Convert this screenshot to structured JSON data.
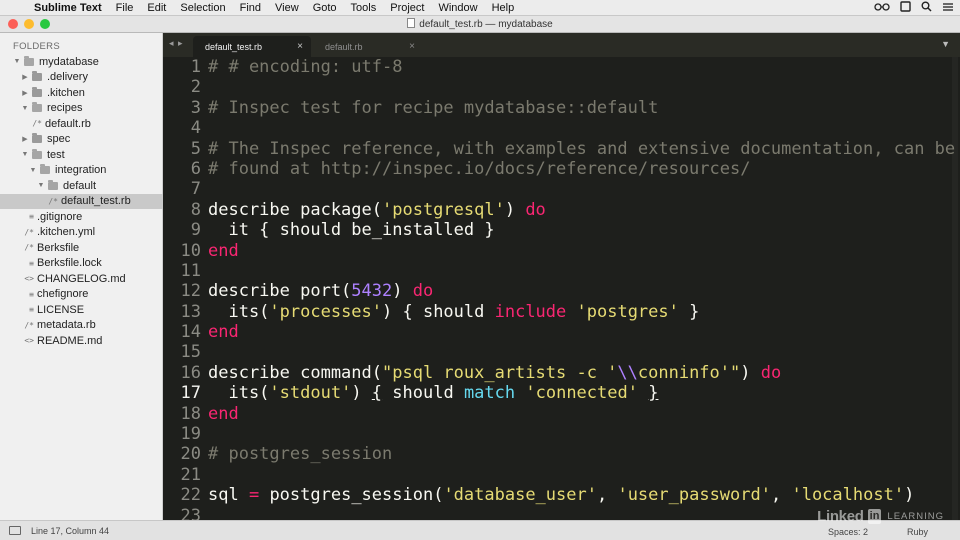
{
  "menubar": {
    "apple_icon": "",
    "app_name": "Sublime Text",
    "items": [
      "File",
      "Edit",
      "Selection",
      "Find",
      "View",
      "Goto",
      "Tools",
      "Project",
      "Window",
      "Help"
    ],
    "right_icons": [
      "glasses-icon",
      "square-icon",
      "search-icon",
      "list-icon"
    ]
  },
  "window": {
    "title": "default_test.rb — mydatabase"
  },
  "sidebar": {
    "header": "FOLDERS",
    "tree": [
      {
        "label": "mydatabase",
        "type": "folder",
        "open": true,
        "depth": 0
      },
      {
        "label": ".delivery",
        "type": "folder",
        "open": false,
        "depth": 1
      },
      {
        "label": ".kitchen",
        "type": "folder",
        "open": false,
        "depth": 1
      },
      {
        "label": "recipes",
        "type": "folder",
        "open": true,
        "depth": 1
      },
      {
        "label": "default.rb",
        "type": "file",
        "glyph": "/*",
        "depth": 2
      },
      {
        "label": "spec",
        "type": "folder",
        "open": false,
        "depth": 1
      },
      {
        "label": "test",
        "type": "folder",
        "open": true,
        "depth": 1
      },
      {
        "label": "integration",
        "type": "folder",
        "open": true,
        "depth": 2
      },
      {
        "label": "default",
        "type": "folder",
        "open": true,
        "depth": 3
      },
      {
        "label": "default_test.rb",
        "type": "file",
        "glyph": "/*",
        "depth": 4,
        "selected": true
      },
      {
        "label": ".gitignore",
        "type": "file",
        "glyph": "≡",
        "depth": 1
      },
      {
        "label": ".kitchen.yml",
        "type": "file",
        "glyph": "/*",
        "depth": 1
      },
      {
        "label": "Berksfile",
        "type": "file",
        "glyph": "/*",
        "depth": 1
      },
      {
        "label": "Berksfile.lock",
        "type": "file",
        "glyph": "≡",
        "depth": 1
      },
      {
        "label": "CHANGELOG.md",
        "type": "file",
        "glyph": "<>",
        "depth": 1
      },
      {
        "label": "chefignore",
        "type": "file",
        "glyph": "≡",
        "depth": 1
      },
      {
        "label": "LICENSE",
        "type": "file",
        "glyph": "≡",
        "depth": 1
      },
      {
        "label": "metadata.rb",
        "type": "file",
        "glyph": "/*",
        "depth": 1
      },
      {
        "label": "README.md",
        "type": "file",
        "glyph": "<>",
        "depth": 1
      }
    ]
  },
  "tabs": {
    "nav": "◂ ▸",
    "items": [
      {
        "label": "default_test.rb",
        "active": true,
        "close": "×"
      },
      {
        "label": "default.rb",
        "active": false,
        "close": "×"
      }
    ],
    "menu": "▼"
  },
  "editor": {
    "current_line": 17,
    "lines": [
      {
        "n": "1",
        "tokens": [
          {
            "c": "cm",
            "t": "# # encoding: utf-8"
          }
        ]
      },
      {
        "n": "2",
        "tokens": []
      },
      {
        "n": "3",
        "tokens": [
          {
            "c": "cm",
            "t": "# Inspec test for recipe mydatabase::default"
          }
        ]
      },
      {
        "n": "4",
        "tokens": []
      },
      {
        "n": "5",
        "tokens": [
          {
            "c": "cm",
            "t": "# The Inspec reference, with examples and extensive documentation, can be"
          }
        ]
      },
      {
        "n": "6",
        "tokens": [
          {
            "c": "cm",
            "t": "# found at http://inspec.io/docs/reference/resources/"
          }
        ]
      },
      {
        "n": "7",
        "tokens": []
      },
      {
        "n": "8",
        "tokens": [
          {
            "c": "",
            "t": "describe package("
          },
          {
            "c": "st",
            "t": "'postgresql'"
          },
          {
            "c": "",
            "t": ") "
          },
          {
            "c": "kw",
            "t": "do"
          }
        ]
      },
      {
        "n": "9",
        "tokens": [
          {
            "c": "",
            "t": "  it { should be_installed }"
          }
        ]
      },
      {
        "n": "10",
        "tokens": [
          {
            "c": "kw",
            "t": "end"
          }
        ]
      },
      {
        "n": "11",
        "tokens": []
      },
      {
        "n": "12",
        "tokens": [
          {
            "c": "",
            "t": "describe port("
          },
          {
            "c": "nm",
            "t": "5432"
          },
          {
            "c": "",
            "t": ") "
          },
          {
            "c": "kw",
            "t": "do"
          }
        ]
      },
      {
        "n": "13",
        "tokens": [
          {
            "c": "",
            "t": "  its("
          },
          {
            "c": "st",
            "t": "'processes'"
          },
          {
            "c": "",
            "t": ") { should "
          },
          {
            "c": "kw",
            "t": "include"
          },
          {
            "c": "",
            "t": " "
          },
          {
            "c": "st",
            "t": "'postgres'"
          },
          {
            "c": "",
            "t": " }"
          }
        ]
      },
      {
        "n": "14",
        "tokens": [
          {
            "c": "kw",
            "t": "end"
          }
        ]
      },
      {
        "n": "15",
        "tokens": []
      },
      {
        "n": "16",
        "tokens": [
          {
            "c": "",
            "t": "describe command("
          },
          {
            "c": "st",
            "t": "\"psql roux_artists -c '"
          },
          {
            "c": "nm",
            "t": "\\\\"
          },
          {
            "c": "st",
            "t": "conninfo'\""
          },
          {
            "c": "",
            "t": ") "
          },
          {
            "c": "kw",
            "t": "do"
          }
        ]
      },
      {
        "n": "17",
        "tokens": [
          {
            "c": "",
            "t": "  its("
          },
          {
            "c": "st",
            "t": "'stdout'"
          },
          {
            "c": "",
            "t": ") "
          },
          {
            "c": "cursor-brace",
            "t": "{"
          },
          {
            "c": "",
            "t": " should "
          },
          {
            "c": "fn",
            "t": "match"
          },
          {
            "c": "",
            "t": " "
          },
          {
            "c": "st",
            "t": "'connected'"
          },
          {
            "c": "",
            "t": " "
          },
          {
            "c": "cursor-brace",
            "t": "}"
          }
        ]
      },
      {
        "n": "18",
        "tokens": [
          {
            "c": "kw",
            "t": "end"
          }
        ]
      },
      {
        "n": "19",
        "tokens": []
      },
      {
        "n": "20",
        "tokens": [
          {
            "c": "cm",
            "t": "# postgres_session"
          }
        ]
      },
      {
        "n": "21",
        "tokens": []
      },
      {
        "n": "22",
        "tokens": [
          {
            "c": "",
            "t": "sql "
          },
          {
            "c": "kw",
            "t": "="
          },
          {
            "c": "",
            "t": " postgres_session("
          },
          {
            "c": "st",
            "t": "'database_user'"
          },
          {
            "c": "",
            "t": ", "
          },
          {
            "c": "st",
            "t": "'user_password'"
          },
          {
            "c": "",
            "t": ", "
          },
          {
            "c": "st",
            "t": "'localhost'"
          },
          {
            "c": "",
            "t": ")"
          }
        ]
      },
      {
        "n": "23",
        "tokens": []
      }
    ]
  },
  "statusbar": {
    "position": "Line 17, Column 44",
    "spaces": "Spaces: 2",
    "syntax": "Ruby"
  },
  "watermark": {
    "linked": "Linked",
    "in": "in",
    "learning": "LEARNING"
  },
  "colors": {
    "editor_bg": "#1e1f1c",
    "string": "#e6db74",
    "keyword": "#f92672",
    "number": "#ae81ff",
    "function": "#66d9ef",
    "comment": "#7b7a6e"
  }
}
